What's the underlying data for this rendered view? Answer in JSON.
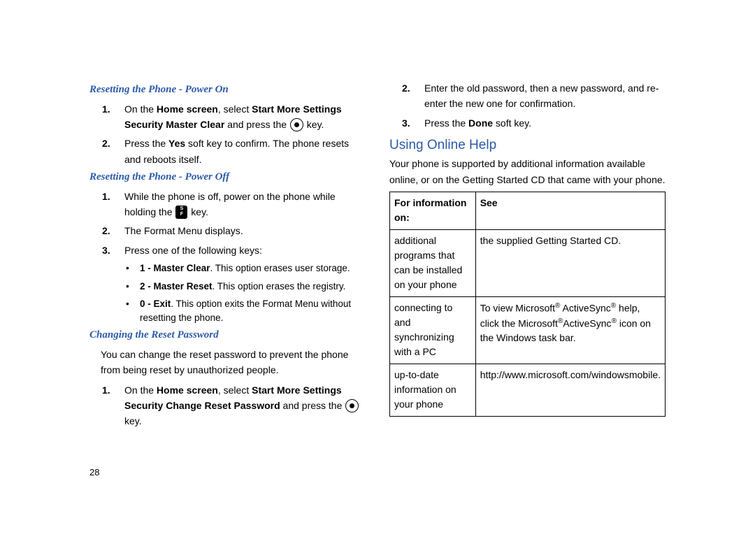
{
  "page_number": "28",
  "left": {
    "section1": {
      "heading": "Resetting the Phone - Power On",
      "steps": {
        "n1": "1.",
        "s1_a": "On the ",
        "s1_b": "Home screen",
        "s1_c": ", select ",
        "s1_d": "Start",
        "s1_e": "More",
        "s1_f": "Settings",
        "s1_g": "Security",
        "s1_h": "Master Clear",
        "s1_i": " and press the ",
        "s1_j": " key.",
        "n2": "2.",
        "s2_a": "Press the ",
        "s2_b": "Yes",
        "s2_c": " soft key to confirm. The phone resets and reboots itself."
      }
    },
    "section2": {
      "heading": "Resetting the Phone - Power Off",
      "steps": {
        "n1": "1.",
        "s1": "While the phone is off, power on the phone while holding the ",
        "s1b": " key.",
        "n2": "2.",
        "s2": "The Format Menu displays.",
        "n3": "3.",
        "s3": "Press one of the following keys:"
      },
      "bullets": {
        "b1a": "1 - Master Clear",
        "b1b": ". This option erases user storage.",
        "b2a": "2 - Master Reset",
        "b2b": ". This option erases the registry.",
        "b3a": "0 - Exit",
        "b3b": ". This option exits the Format Menu without resetting the phone."
      }
    },
    "section3": {
      "heading": "Changing the Reset Password",
      "intro": "You can change the reset password to prevent the phone from being reset by unauthorized people.",
      "steps": {
        "n1": "1.",
        "s1_a": "On the ",
        "s1_b": "Home screen",
        "s1_c": ", select ",
        "s1_d": "Start",
        "s1_e": "More",
        "s1_f": "Settings",
        "s1_g": "Security",
        "s1_h": "Change Reset Password",
        "s1_i": " and press the ",
        "s1_j": " key."
      }
    }
  },
  "right": {
    "cont": {
      "n2": "2.",
      "s2": "Enter the old password, then a new password, and re-enter the new one for confirmation.",
      "n3": "3.",
      "s3a": "Press the ",
      "s3b": "Done",
      "s3c": " soft key."
    },
    "section4": {
      "heading": "Using Online Help",
      "intro": "Your phone is supported by additional information available online, or on the Getting Started CD that came with your phone.",
      "table": {
        "h1": "For information on:",
        "h2": "See",
        "r1c1": "additional programs that can be installed on your phone",
        "r1c2": "the supplied Getting Started CD.",
        "r2c1": "connecting to and synchronizing with a PC",
        "r2c2a": "To view Microsoft",
        "r2c2b": " ActiveSync",
        "r2c2c": " help, click the Microsoft",
        "r2c2d": "ActiveSync",
        "r2c2e": " icon on the Windows task bar.",
        "r3c1": "up-to-date information on your phone",
        "r3c2": "http://www.microsoft.com/windowsmobile."
      }
    }
  },
  "glyphs": {
    "reg": "®",
    "arrow": " "
  }
}
